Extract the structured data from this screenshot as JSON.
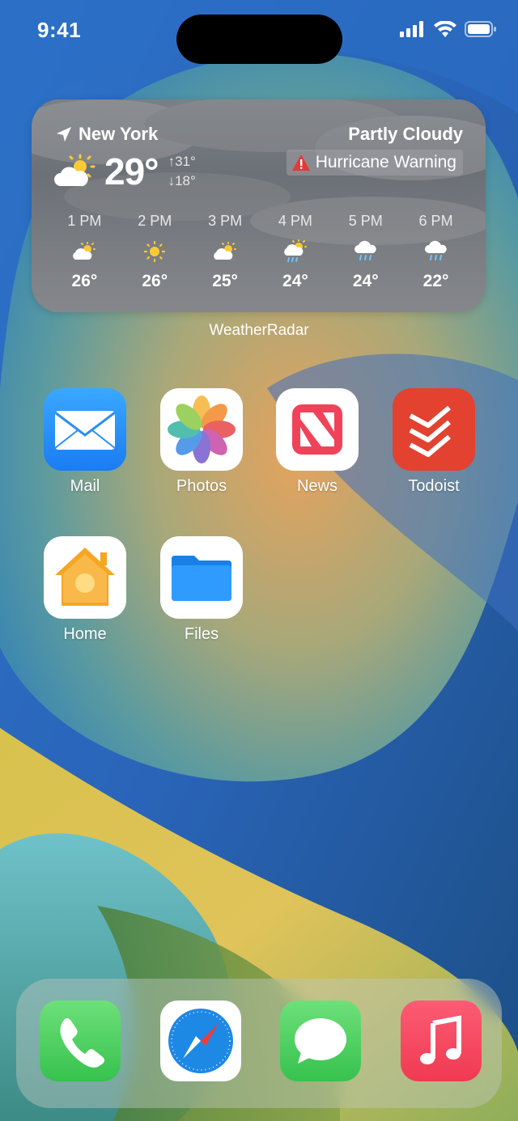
{
  "status": {
    "time": "9:41"
  },
  "weather": {
    "location": "New York",
    "condition": "Partly Cloudy",
    "temperature": "29°",
    "high": "↑31°",
    "low": "↓18°",
    "warning": "Hurricane Warning",
    "hours": [
      {
        "time": "1 PM",
        "icon": "partly-sunny-icon",
        "temp": "26°"
      },
      {
        "time": "2 PM",
        "icon": "sun-icon",
        "temp": "26°"
      },
      {
        "time": "3 PM",
        "icon": "partly-sunny-icon",
        "temp": "25°"
      },
      {
        "time": "4 PM",
        "icon": "sun-rain-icon",
        "temp": "24°"
      },
      {
        "time": "5 PM",
        "icon": "rain-icon",
        "temp": "24°"
      },
      {
        "time": "6 PM",
        "icon": "rain-icon",
        "temp": "22°"
      }
    ],
    "widget_name": "WeatherRadar"
  },
  "apps": [
    {
      "label": "Mail",
      "icon": "mail-icon"
    },
    {
      "label": "Photos",
      "icon": "photos-icon"
    },
    {
      "label": "News",
      "icon": "news-icon"
    },
    {
      "label": "Todoist",
      "icon": "todoist-icon"
    },
    {
      "label": "Home",
      "icon": "home-icon"
    },
    {
      "label": "Files",
      "icon": "files-icon"
    }
  ],
  "dock": [
    {
      "icon": "phone-icon"
    },
    {
      "icon": "safari-icon"
    },
    {
      "icon": "messages-icon"
    },
    {
      "icon": "music-icon"
    }
  ],
  "colors": {
    "mail": "#1f8ff5",
    "news": "#f0435a",
    "todoist": "#e2422f",
    "home": "#f5a623",
    "files": "#1d8bf0",
    "phone": "#4cd964",
    "messages": "#3fd152",
    "music": "#f5485a"
  }
}
